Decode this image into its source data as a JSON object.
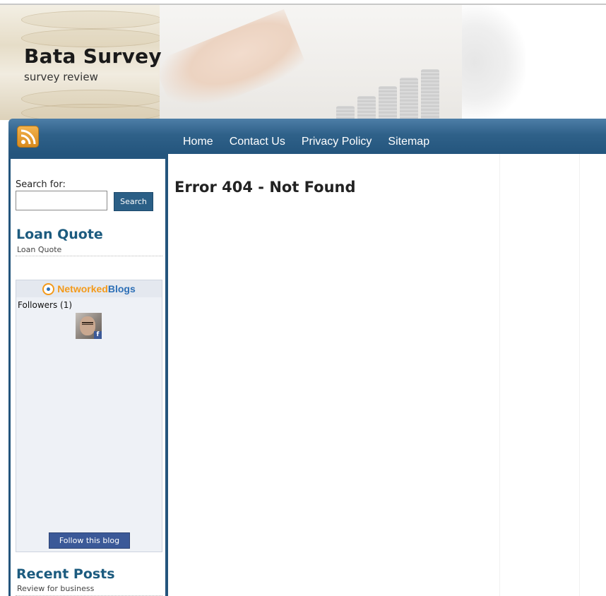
{
  "site": {
    "title": "Bata Survey",
    "tagline": "survey review"
  },
  "nav": {
    "rss_icon": "rss-feed-icon",
    "links": [
      "Home",
      "Contact Us",
      "Privacy Policy",
      "Sitemap"
    ]
  },
  "sidebar": {
    "search": {
      "label": "Search for:",
      "input_value": "",
      "button_label": "Search"
    },
    "loan_quote": {
      "title": "Loan Quote",
      "link": "Loan Quote"
    },
    "networked_blogs": {
      "logo_part1": "Networked",
      "logo_part2": "Blogs",
      "followers_label": "Followers (1)",
      "follow_button": "Follow this blog"
    },
    "recent_posts": {
      "title": "Recent Posts",
      "items": [
        "Review for business"
      ]
    }
  },
  "main": {
    "heading": "Error 404 - Not Found"
  },
  "colors": {
    "nav_bar": "#2f6189",
    "widget_title": "#1c5b7f",
    "rss_orange": "#e69a2a",
    "facebook_blue": "#3b5998"
  }
}
